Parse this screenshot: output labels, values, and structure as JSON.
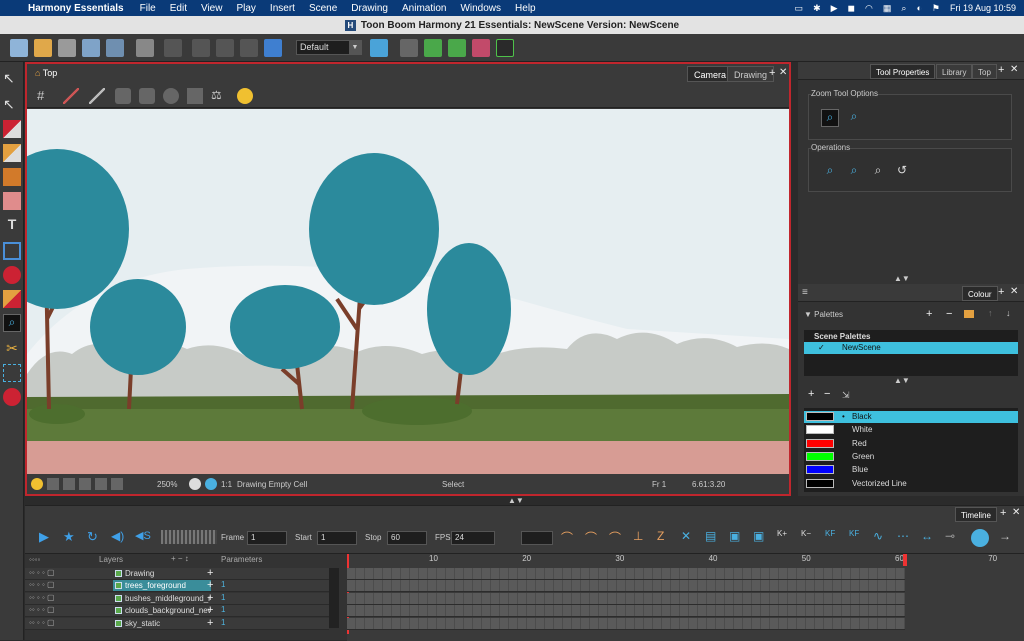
{
  "menubar": {
    "app": "Harmony Essentials",
    "items": [
      "File",
      "Edit",
      "View",
      "Play",
      "Insert",
      "Scene",
      "Drawing",
      "Animation",
      "Windows",
      "Help"
    ],
    "clock": "Fri 19 Aug  10:59"
  },
  "window": {
    "title": "Toon Boom Harmony 21 Essentials: NewScene Version: NewScene"
  },
  "toolbar": {
    "view_select": "Default"
  },
  "view": {
    "breadcrumb": "Top",
    "tabs": [
      "Camera",
      "Drawing"
    ],
    "active_tab": "Camera",
    "status": {
      "zoom": "250%",
      "ratio": "1:1",
      "cell": "Drawing Empty Cell",
      "tool": "Select",
      "frame": "Fr 1",
      "coords": "6.61:3.20"
    }
  },
  "tool_properties": {
    "tabs": [
      "Tool Properties",
      "Library",
      "Top"
    ],
    "zoom_group": "Zoom Tool Options",
    "operations_group": "Operations"
  },
  "colour": {
    "tab": "Colour",
    "palettes_label": "Palettes",
    "scene_palettes": "Scene Palettes",
    "palette_name": "NewScene",
    "swatches": [
      {
        "name": "Black",
        "color": "#000000",
        "selected": true
      },
      {
        "name": "White",
        "color": "#ffffff"
      },
      {
        "name": "Red",
        "color": "#ff0000"
      },
      {
        "name": "Green",
        "color": "#00ff00"
      },
      {
        "name": "Blue",
        "color": "#0000ff"
      },
      {
        "name": "Vectorized Line",
        "color": "#000000"
      }
    ]
  },
  "timeline": {
    "tab": "Timeline",
    "frame_label": "Frame",
    "frame_value": "1",
    "start_label": "Start",
    "start_value": "1",
    "stop_label": "Stop",
    "stop_value": "60",
    "fps_label": "FPS",
    "fps_value": "24",
    "layers_header": "Layers",
    "params_header": "Parameters",
    "layers": [
      {
        "name": "Drawing",
        "param": "",
        "selected": false
      },
      {
        "name": "trees_foreground",
        "param": "1",
        "selected": true
      },
      {
        "name": "bushes_middleground_n",
        "param": "1",
        "selected": false
      },
      {
        "name": "clouds_background_new",
        "param": "1",
        "selected": false
      },
      {
        "name": "sky_static",
        "param": "1",
        "selected": false
      }
    ],
    "ticks": [
      "10",
      "20",
      "30",
      "40",
      "50",
      "60",
      "70"
    ]
  }
}
